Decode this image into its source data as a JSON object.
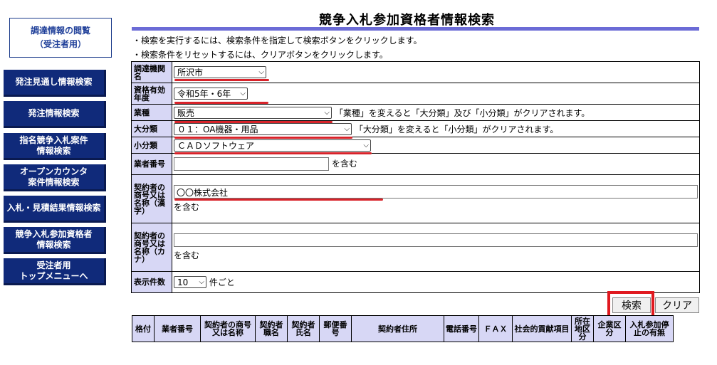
{
  "nav": {
    "title": "調達情報の閲覧\n（受注者用）",
    "items": [
      "発注見通し情報検索",
      "発注情報検索",
      "指名競争入札案件\n情報検索",
      "オープンカウンタ\n案件情報検索",
      "入札・見積結果情報検索",
      "競争入札参加資格者\n情報検索",
      "受注者用\nトップメニューへ"
    ]
  },
  "page": {
    "title": "競争入札参加資格者情報検索",
    "note1": "・検索を実行するには、検索条件を指定して検索ボタンをクリックします。",
    "note2": "・検索条件をリセットするには、クリアボタンをクリックします。"
  },
  "form": {
    "org_label": "調達機関名",
    "org_value": "所沢市",
    "year_label": "資格有効年度",
    "year_value": "令和5年・6年",
    "industry_label": "業種",
    "industry_value": "販売",
    "industry_note": "「業種」を変えると「大分類」及び「小分類」がクリアされます。",
    "major_label": "大分類",
    "major_value": "０１：OA機器・用品",
    "major_note": "「大分類」を変えると「小分類」がクリアされます。",
    "minor_label": "小分類",
    "minor_value": "ＣＡＤソフトウェア",
    "vendor_no_label": "業者番号",
    "vendor_no_value": "",
    "contains": "を含む",
    "name_kanji_label": "契約者の商号又は名称（漢字）",
    "name_kanji_value": "〇〇株式会社",
    "name_kana_label": "契約者の商号又は名称（カナ）",
    "name_kana_value": "",
    "count_label": "表示件数",
    "count_value": "10",
    "count_suffix": "件ごと"
  },
  "buttons": {
    "search": "検索",
    "clear": "クリア"
  },
  "results": {
    "headers": [
      "格付",
      "業者番号",
      "契約者の商号又は名称",
      "契約者職名",
      "契約者氏名",
      "郵便番号",
      "契約者住所",
      "電話番号",
      "ＦＡＸ",
      "社会的貢献項目",
      "所在地区分",
      "企業区分",
      "入札参加停止の有無"
    ]
  },
  "colors": {
    "nav_bg": "#102a7a",
    "label_bg": "#d7d7f5",
    "rule": "#6b6bd6",
    "highlight": "#e0191f"
  }
}
